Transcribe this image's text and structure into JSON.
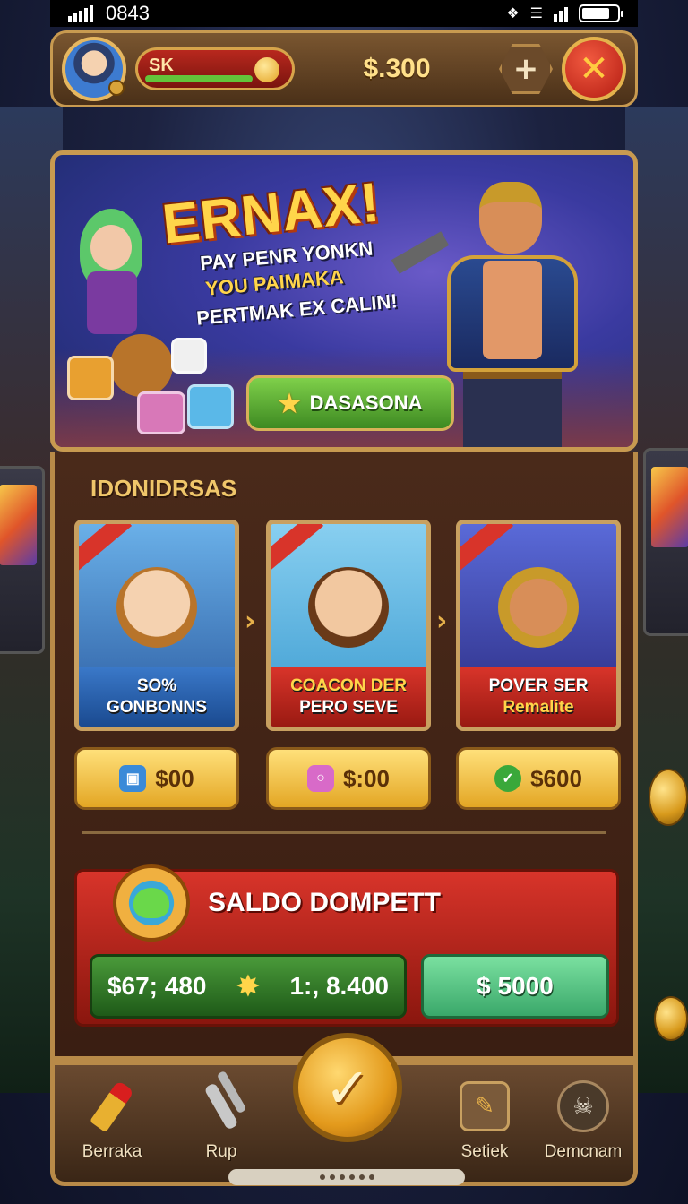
{
  "status_bar": {
    "time": "0843"
  },
  "top_bar": {
    "player_name": "SK",
    "xp_progress": 0.7,
    "coins": "$.300",
    "add_icon": "plus-icon",
    "close_icon": "close-icon"
  },
  "banner": {
    "title": "ERNAX!",
    "line1": "PAY PENR YONKN",
    "line2": "YOU PAIMAKA",
    "line3": "PERTMAK EX CALIN!",
    "cta_label": "DASASONA",
    "cta_icon": "star-icon"
  },
  "offers": {
    "section_title": "IDONIDRSAS",
    "cards": [
      {
        "line1": "SO%",
        "line2": "GONBONNS",
        "price": "$00",
        "price_icon": "gift-icon"
      },
      {
        "line1": "COACON DER",
        "line2": "PERO SEVE",
        "price": "$:00",
        "price_icon": "gem-icon"
      },
      {
        "line1": "POVER SER",
        "line2": "Remalite",
        "price": "$600",
        "price_icon": "check-icon"
      }
    ]
  },
  "wallet": {
    "title": "SALDO DOMPETT",
    "balance_primary": "$67; 480",
    "balance_secondary": "1:, 8.400",
    "balance_action": "$ 5000"
  },
  "bottom_nav": {
    "items": [
      {
        "label": "Berraka",
        "icon": "lipstick-icon"
      },
      {
        "label": "Rup",
        "icon": "tool-icon"
      },
      {
        "label": "Setiek",
        "icon": "board-icon"
      },
      {
        "label": "Demcnam",
        "icon": "skull-icon"
      }
    ],
    "center_icon": "check-icon"
  },
  "colors": {
    "gold": "#f0c66a",
    "panel_brown": "#4a2a1a",
    "wallet_red": "#d8342a",
    "balance_green": "#4a9a3a",
    "action_green": "#7ae0a0"
  }
}
